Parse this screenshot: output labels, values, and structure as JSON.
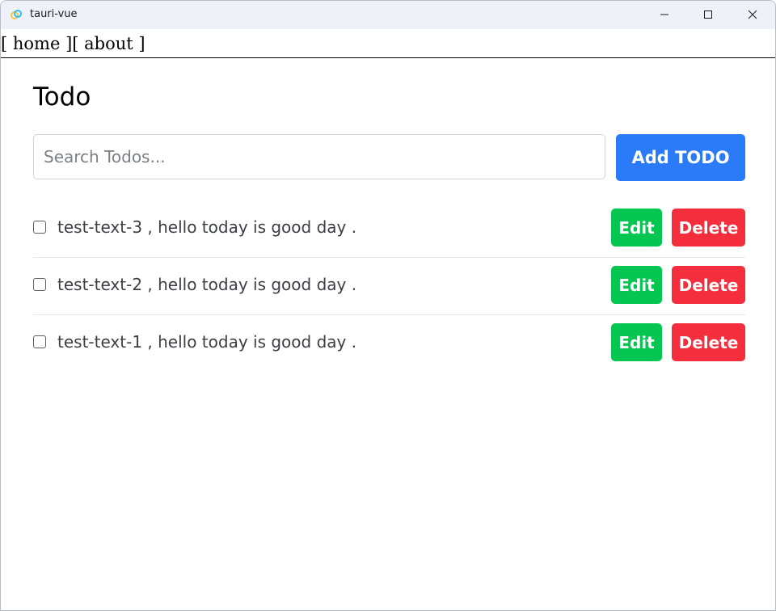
{
  "window": {
    "title": "tauri-vue",
    "app_icon": "tauri-icon",
    "controls": [
      "minimize-icon",
      "maximize-icon",
      "close-icon"
    ]
  },
  "nav": {
    "open1": "[ ",
    "home": "home",
    "sep": " ][ ",
    "about": "about",
    "close": " ]"
  },
  "page": {
    "title": "Todo"
  },
  "search": {
    "placeholder": "Search Todos...",
    "value": ""
  },
  "add_button": {
    "label": "Add TODO",
    "color": "#2b7af7"
  },
  "todos": [
    {
      "text": "test-text-3 , hello today is good day .",
      "checked": false,
      "edit_label": "Edit",
      "delete_label": "Delete"
    },
    {
      "text": "test-text-2 , hello today is good day .",
      "checked": false,
      "edit_label": "Edit",
      "delete_label": "Delete"
    },
    {
      "text": "test-text-1 , hello today is good day .",
      "checked": false,
      "edit_label": "Edit",
      "delete_label": "Delete"
    }
  ],
  "colors": {
    "edit": "#04c651",
    "delete": "#f52e3d",
    "titlebar": "#eff1f9"
  }
}
